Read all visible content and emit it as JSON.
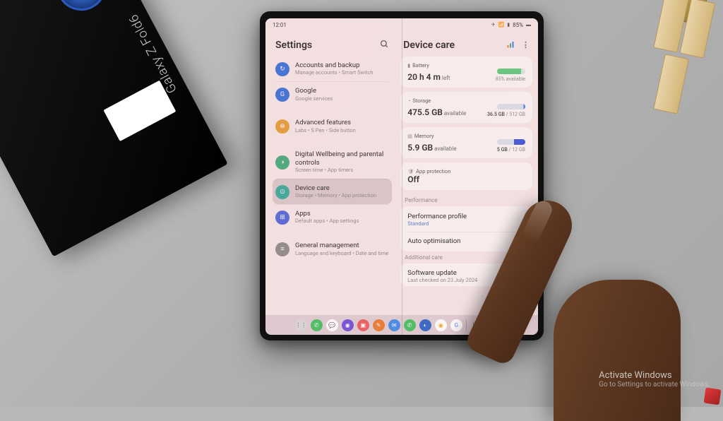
{
  "box": {
    "label": "Galaxy Z Fold6"
  },
  "statusbar": {
    "time": "12:01",
    "signal": "85%"
  },
  "settings": {
    "title": "Settings",
    "items": [
      {
        "icon": "↻",
        "iconClass": "ic-blue",
        "name": "accounts-backup",
        "title": "Accounts and backup",
        "sub": "Manage accounts • Smart Switch"
      },
      {
        "icon": "G",
        "iconClass": "ic-google",
        "name": "google",
        "title": "Google",
        "sub": "Google services"
      },
      {
        "icon": "⊕",
        "iconClass": "ic-orange",
        "name": "advanced-features",
        "title": "Advanced features",
        "sub": "Labs • S Pen • Side button"
      },
      {
        "icon": "◑",
        "iconClass": "ic-green",
        "name": "digital-wellbeing",
        "title": "Digital Wellbeing and parental controls",
        "sub": "Screen time • App timers"
      },
      {
        "icon": "⊙",
        "iconClass": "ic-teal",
        "name": "device-care",
        "title": "Device care",
        "sub": "Storage • Memory • App protection",
        "selected": true
      },
      {
        "icon": "⊞",
        "iconClass": "ic-apps",
        "name": "apps",
        "title": "Apps",
        "sub": "Default apps • App settings"
      },
      {
        "icon": "≡",
        "iconClass": "ic-gray",
        "name": "general-management",
        "title": "General management",
        "sub": "Language and keyboard • Date and time"
      }
    ]
  },
  "devicecare": {
    "title": "Device care",
    "battery": {
      "label": "Battery",
      "value": "20 h 4 m",
      "unit": "left",
      "meta": "85% available"
    },
    "storage": {
      "label": "Storage",
      "value": "475.5 GB",
      "unit": "available",
      "meta_used": "36.5 GB",
      "meta_total": " / 512 GB"
    },
    "memory": {
      "label": "Memory",
      "value": "5.9 GB",
      "unit": "available",
      "meta_used": "5 GB",
      "meta_total": " / 12 GB"
    },
    "appprotection": {
      "label": "App protection",
      "value": "Off"
    },
    "performance_header": "Performance",
    "perf_profile": {
      "title": "Performance profile",
      "sub": "Standard"
    },
    "auto_opt": {
      "title": "Auto optimisation"
    },
    "additional_header": "Additional care",
    "software_update": {
      "title": "Software update",
      "sub": "Last checked on 23 July 2024"
    }
  },
  "dock": {
    "icons": [
      {
        "name": "apps-drawer",
        "bg": "#d8d8d8",
        "glyph": "⋮⋮",
        "fg": "#555"
      },
      {
        "name": "phone",
        "bg": "#3fbf60",
        "glyph": "✆"
      },
      {
        "name": "chat",
        "bg": "#ffffff",
        "glyph": "💬",
        "fg": "#3a62d8"
      },
      {
        "name": "browser",
        "bg": "#6a4ad8",
        "glyph": "◉"
      },
      {
        "name": "gallery",
        "bg": "#e85a5a",
        "glyph": "▣"
      },
      {
        "name": "note",
        "bg": "#e87a2a",
        "glyph": "✎"
      },
      {
        "name": "messages",
        "bg": "#3a8ae8",
        "glyph": "✉"
      },
      {
        "name": "whatsapp",
        "bg": "#3fbf60",
        "glyph": "✆"
      },
      {
        "name": "outlook",
        "bg": "#2a62c8",
        "glyph": "◐"
      },
      {
        "name": "chrome",
        "bg": "#ffffff",
        "glyph": "◉",
        "fg": "#e8b020"
      },
      {
        "name": "google",
        "bg": "#ffffff",
        "glyph": "G",
        "fg": "#4285f4"
      }
    ]
  },
  "watermark": {
    "title": "Activate Windows",
    "sub": "Go to Settings to activate Windows."
  }
}
